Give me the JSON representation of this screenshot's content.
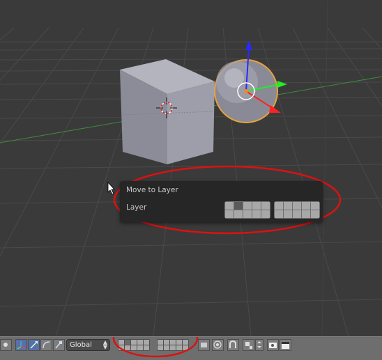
{
  "popup": {
    "title": "Move to Layer",
    "layer_label": "Layer",
    "active_layer_index": 1
  },
  "header": {
    "transform_orientation": "Global",
    "header_active_layer_index": 1
  },
  "colors": {
    "viewport_bg": "#3a3a3a",
    "grid_line": "#4a4a4a",
    "x_axis": "#3f8a3f",
    "selection_outline": "#e8a23a",
    "annotation": "#dd1111",
    "manip_z": "#2a2aff",
    "manip_x": "#ff2222",
    "manip_y": "#22ee22"
  },
  "icons": [
    "pivot-icon",
    "manipulator-icon",
    "translate-icon",
    "rotate-icon",
    "scale-icon",
    "camera-icon",
    "snap-icon",
    "render-icon",
    "clapper-icon"
  ]
}
